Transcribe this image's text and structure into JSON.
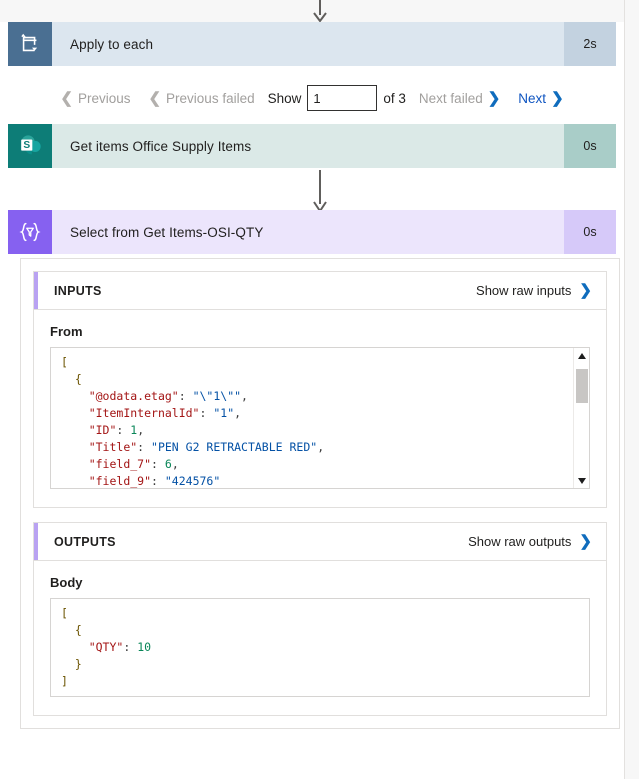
{
  "cards": [
    {
      "name": "apply-to-each",
      "icon": "loop-icon",
      "title": "Apply to each",
      "duration": "2s",
      "status": "succeeded"
    },
    {
      "name": "get-items",
      "icon": "sharepoint-icon",
      "title": "Get items Office Supply Items",
      "duration": "0s",
      "status": "succeeded"
    },
    {
      "name": "select-action",
      "icon": "select-braces-filter-icon",
      "title": "Select from Get Items-OSI-QTY",
      "duration": "0s",
      "status": "succeeded"
    }
  ],
  "pager": {
    "previous_label": "Previous",
    "previous_failed_label": "Previous failed",
    "show_label": "Show",
    "page_value": "1",
    "page_placeholder": "",
    "of_label": "of 3",
    "next_failed_label": "Next failed",
    "next_label": "Next"
  },
  "inputs": {
    "section_title": "INPUTS",
    "raw_link": "Show raw inputs",
    "field_label": "From",
    "code_lines": [
      {
        "indent": 0,
        "tokens": [
          {
            "t": "[",
            "c": "br"
          }
        ]
      },
      {
        "indent": 1,
        "tokens": [
          {
            "t": "{",
            "c": "br"
          }
        ]
      },
      {
        "indent": 2,
        "tokens": [
          {
            "t": "\"@odata.etag\"",
            "c": "k"
          },
          {
            "t": ": ",
            "c": "p"
          },
          {
            "t": "\"\\\"1\\\"\"",
            "c": "s"
          },
          {
            "t": ",",
            "c": "p"
          }
        ]
      },
      {
        "indent": 2,
        "tokens": [
          {
            "t": "\"ItemInternalId\"",
            "c": "k"
          },
          {
            "t": ": ",
            "c": "p"
          },
          {
            "t": "\"1\"",
            "c": "s"
          },
          {
            "t": ",",
            "c": "p"
          }
        ]
      },
      {
        "indent": 2,
        "tokens": [
          {
            "t": "\"ID\"",
            "c": "k"
          },
          {
            "t": ": ",
            "c": "p"
          },
          {
            "t": "1",
            "c": "n"
          },
          {
            "t": ",",
            "c": "p"
          }
        ]
      },
      {
        "indent": 2,
        "tokens": [
          {
            "t": "\"Title\"",
            "c": "k"
          },
          {
            "t": ": ",
            "c": "p"
          },
          {
            "t": "\"PEN G2 RETRACTABLE RED\"",
            "c": "s"
          },
          {
            "t": ",",
            "c": "p"
          }
        ]
      },
      {
        "indent": 2,
        "tokens": [
          {
            "t": "\"field_7\"",
            "c": "k"
          },
          {
            "t": ": ",
            "c": "p"
          },
          {
            "t": "6",
            "c": "n"
          },
          {
            "t": ",",
            "c": "p"
          }
        ]
      },
      {
        "indent": 2,
        "tokens": [
          {
            "t": "\"field_9\"",
            "c": "k"
          },
          {
            "t": ": ",
            "c": "p"
          },
          {
            "t": "\"424576\"",
            "c": "s"
          }
        ]
      }
    ]
  },
  "outputs": {
    "section_title": "OUTPUTS",
    "raw_link": "Show raw outputs",
    "field_label": "Body",
    "code_lines": [
      {
        "indent": 0,
        "tokens": [
          {
            "t": "[",
            "c": "br"
          }
        ]
      },
      {
        "indent": 1,
        "tokens": [
          {
            "t": "{",
            "c": "br"
          }
        ]
      },
      {
        "indent": 2,
        "tokens": [
          {
            "t": "\"QTY\"",
            "c": "k"
          },
          {
            "t": ": ",
            "c": "p"
          },
          {
            "t": "10",
            "c": "n"
          }
        ]
      },
      {
        "indent": 1,
        "tokens": [
          {
            "t": "}",
            "c": "br"
          }
        ]
      },
      {
        "indent": 0,
        "tokens": [
          {
            "t": "]",
            "c": "br"
          }
        ]
      }
    ]
  },
  "colors": {
    "loop_icon_bg": "#4a6f92",
    "loop_row_bg": "#dce6ef",
    "sharepoint_icon_bg": "#0d7d77",
    "sharepoint_row_bg": "#dbe9e7",
    "select_icon_bg": "#8661f0",
    "select_row_bg": "#ece5fc",
    "success_badge": "#107c41",
    "link_blue": "#0f6cbd",
    "accent_bar": "#b9a2f2"
  }
}
